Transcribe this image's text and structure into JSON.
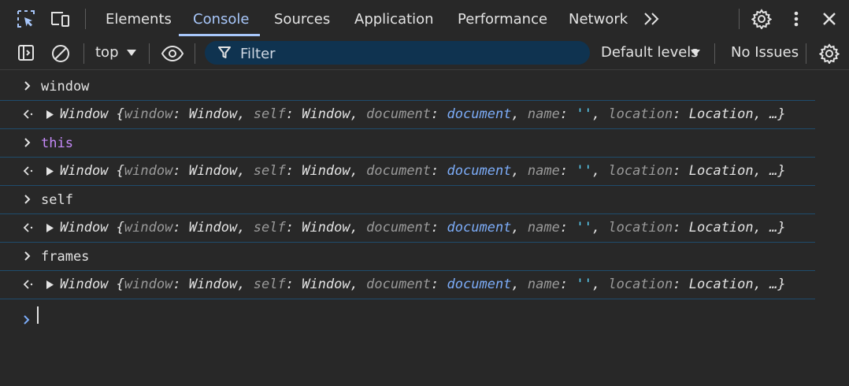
{
  "tabs": {
    "items": [
      {
        "label": "Elements"
      },
      {
        "label": "Console"
      },
      {
        "label": "Sources"
      },
      {
        "label": "Application"
      },
      {
        "label": "Performance"
      },
      {
        "label": "Network"
      }
    ],
    "active": "Console"
  },
  "toolbar": {
    "context_label": "top",
    "filter_placeholder": "Filter",
    "levels_label": "Default levels",
    "issues_label": "No Issues"
  },
  "object_preview": {
    "name": "Window",
    "open_brace": "{",
    "k1": "window",
    "v1": "Window",
    "k2": "self",
    "v2": "Window",
    "k3": "document",
    "v3": "document",
    "k4": "name",
    "v4": "''",
    "k5": "location",
    "v5": "Location",
    "tail": "…}",
    "colon": ":",
    "comma": ","
  },
  "console": {
    "entries": [
      {
        "input": "window"
      },
      {
        "input": "this"
      },
      {
        "input": "self"
      },
      {
        "input": "frames"
      }
    ]
  },
  "colors": {
    "background": "#282828",
    "accent": "#a8c7fa",
    "keyword": "#c58af9",
    "row_border": "#1f4c6d",
    "filter_bg": "#0f3350"
  }
}
